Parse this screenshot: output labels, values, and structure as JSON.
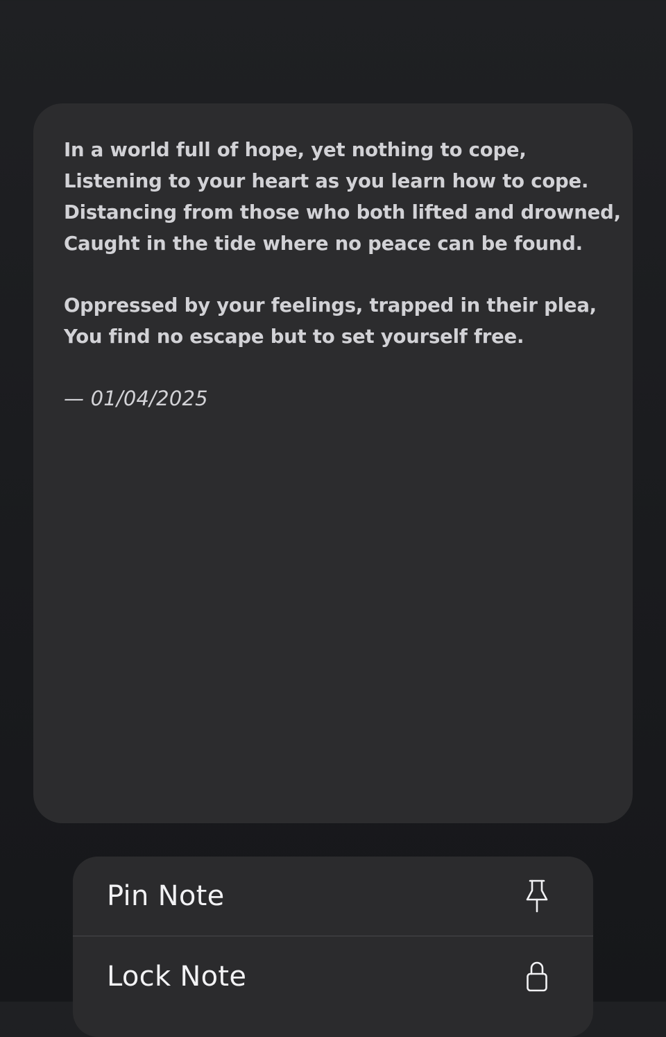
{
  "note": {
    "stanzas": [
      [
        "In a world full of hope, yet nothing to cope,",
        "Listening to your heart as you learn how to cope.",
        "Distancing from those who both lifted and drowned,",
        "Caught in the tide where no peace can be found."
      ],
      [
        "Oppressed by your feelings, trapped in their plea,",
        "You find no escape but to set yourself free."
      ]
    ],
    "signature": "— 01/04/2025"
  },
  "menu": {
    "items": [
      {
        "label": "Pin Note",
        "icon": "pin-icon"
      },
      {
        "label": "Lock Note",
        "icon": "lock-icon"
      }
    ]
  },
  "colors": {
    "background": "#1b1c1f",
    "card": "#2c2c2e",
    "text": "#d2d2d6",
    "menu_text": "#f2f2f4",
    "separator": "#48484c"
  }
}
